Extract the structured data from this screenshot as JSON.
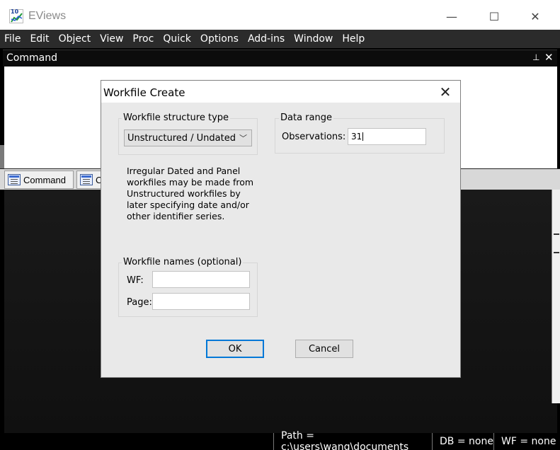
{
  "app": {
    "icon_badge": "10",
    "title": "EViews",
    "window_controls": {
      "minimize": "—",
      "maximize": "☐",
      "close": "✕"
    }
  },
  "menu": [
    "File",
    "Edit",
    "Object",
    "View",
    "Proc",
    "Quick",
    "Options",
    "Add-ins",
    "Window",
    "Help"
  ],
  "command_pane": {
    "title": "Command",
    "pin_glyph": "⊥",
    "close_glyph": "✕",
    "tabs": [
      {
        "label": "Command",
        "icon": "command-window-icon"
      },
      {
        "label": "C",
        "icon": "capture-window-icon"
      }
    ]
  },
  "status_bar": {
    "path": "Path = c:\\users\\wang\\documents",
    "db": "DB = none",
    "wf": "WF = none"
  },
  "dialog": {
    "title": "Workfile Create",
    "close_glyph": "✕",
    "structure": {
      "label": "Workfile structure type",
      "selected": "Unstructured / Undated"
    },
    "data_range": {
      "label": "Data range",
      "observations_label": "Observations:",
      "observations_value": "31"
    },
    "info_text": "Irregular Dated and Panel workfiles may be made from Unstructured workfiles by later specifying date and/or other identifier series.",
    "names": {
      "label": "Workfile names (optional)",
      "wf_label": "WF:",
      "wf_value": "",
      "page_label": "Page:",
      "page_value": ""
    },
    "buttons": {
      "ok": "OK",
      "cancel": "Cancel"
    }
  },
  "colors": {
    "menubar_bg": "#2b2b2b",
    "dialog_body": "#e9e9e9",
    "ok_focus_border": "#0078d7",
    "statusbar_bg": "#000000"
  }
}
